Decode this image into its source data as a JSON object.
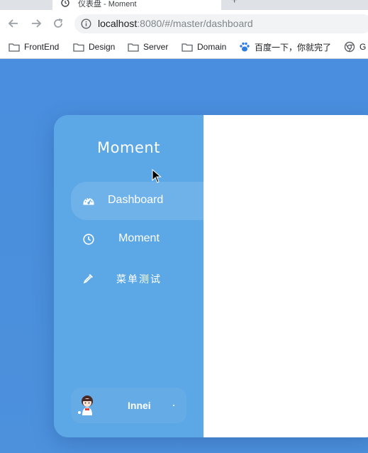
{
  "browser": {
    "tab": {
      "title": "仪表盘 - Moment"
    },
    "address": {
      "host": "localhost",
      "rest": ":8080/#/master/dashboard"
    },
    "bookmarks": [
      {
        "label": "FrontEnd",
        "icon": "folder-icon"
      },
      {
        "label": "Design",
        "icon": "folder-icon"
      },
      {
        "label": "Server",
        "icon": "folder-icon"
      },
      {
        "label": "Domain",
        "icon": "folder-icon"
      },
      {
        "label": "百度一下，你就完了",
        "icon": "baidu-paw-icon"
      },
      {
        "label": "G",
        "icon": "chrome-icon"
      }
    ]
  },
  "app": {
    "brand": "Moment",
    "menu": [
      {
        "label": "Dashboard",
        "icon": "dashboard-gauge-icon",
        "active": true
      },
      {
        "label": "Moment",
        "icon": "clock-icon",
        "active": false
      },
      {
        "label": "菜单测试",
        "icon": "eyedropper-icon",
        "active": false
      }
    ],
    "user": {
      "name": "Innei",
      "avatar": "avatar-icon"
    }
  },
  "colors": {
    "page_background": "#4a8fdc",
    "sidebar": "#5ca7e6",
    "content": "#ffffff"
  }
}
